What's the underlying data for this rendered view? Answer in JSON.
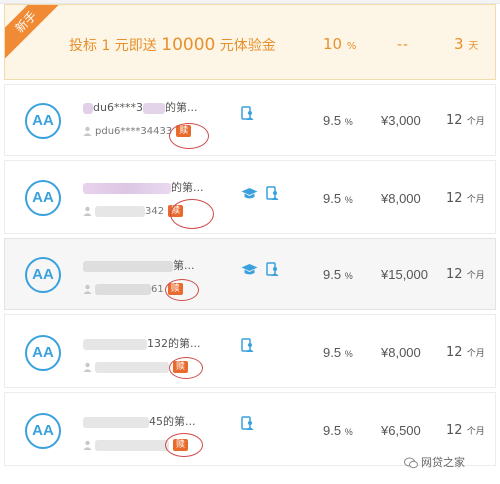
{
  "featured": {
    "tag": "新手",
    "title_prefix": "投标 1 元即送 ",
    "title_amount": "10000",
    "title_suffix": " 元体验金",
    "rate": "10",
    "rate_unit": "%",
    "amount": "--",
    "term": "3",
    "term_unit": "天"
  },
  "loans": [
    {
      "avatar": "AA",
      "title_visible_a": "du6****3",
      "title_visible_b": "的第...",
      "user": "pdu6****34433",
      "badge": "赎",
      "icons": [
        "user-card"
      ],
      "rate": "9.5",
      "rate_unit": "%",
      "amount": "¥3,000",
      "term": "12",
      "term_unit": "个月"
    },
    {
      "avatar": "AA",
      "title_visible_a": "",
      "title_visible_b": "的第...",
      "user": "342",
      "badge": "赎",
      "icons": [
        "graduation-cap",
        "user-card"
      ],
      "rate": "9.5",
      "rate_unit": "%",
      "amount": "¥8,000",
      "term": "12",
      "term_unit": "个月"
    },
    {
      "avatar": "AA",
      "title_visible_a": "",
      "title_visible_b": "第...",
      "user": "61",
      "badge": "赎",
      "icons": [
        "graduation-cap",
        "user-card"
      ],
      "rate": "9.5",
      "rate_unit": "%",
      "amount": "¥15,000",
      "term": "12",
      "term_unit": "个月"
    },
    {
      "avatar": "AA",
      "title_visible_a": "",
      "title_visible_b": "132的第...",
      "user": "",
      "badge": "赎",
      "icons": [
        "user-card"
      ],
      "rate": "9.5",
      "rate_unit": "%",
      "amount": "¥8,000",
      "term": "12",
      "term_unit": "个月"
    },
    {
      "avatar": "AA",
      "title_visible_a": "",
      "title_visible_b": "45的第...",
      "user": "",
      "badge": "赎",
      "icons": [
        "user-card"
      ],
      "rate": "9.5",
      "rate_unit": "%",
      "amount": "¥6,500",
      "term": "12",
      "term_unit": "个月"
    }
  ],
  "watermark": "网贷之家",
  "colors": {
    "accent": "#e8902c",
    "blue": "#3aa1dd",
    "badge": "#e86a2c",
    "circle": "#cf4a4a"
  }
}
